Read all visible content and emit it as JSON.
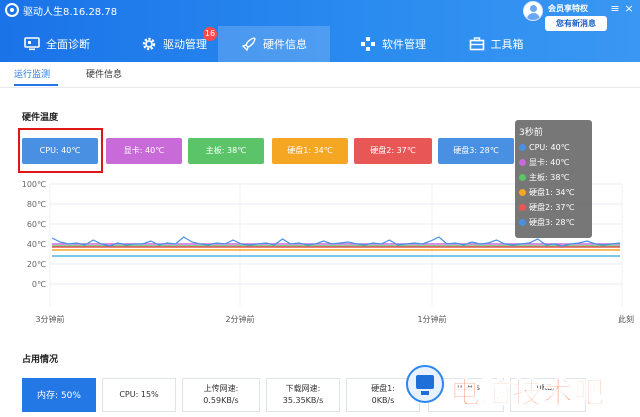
{
  "app": {
    "title": "驱动人生8.16.28.78",
    "vip_label": "会员享特权",
    "sale_badge": "您有新消息"
  },
  "tabs": [
    {
      "label": "全面诊断",
      "icon": "monitor-icon"
    },
    {
      "label": "驱动管理",
      "icon": "gear-icon",
      "badge": "16"
    },
    {
      "label": "硬件信息",
      "icon": "rocket-icon",
      "active": true
    },
    {
      "label": "软件管理",
      "icon": "apps-icon"
    },
    {
      "label": "工具箱",
      "icon": "toolbox-icon"
    }
  ],
  "subtabs": [
    {
      "label": "运行监测",
      "active": true
    },
    {
      "label": "硬件信息"
    }
  ],
  "temperature": {
    "section_title": "硬件温度",
    "buttons": [
      {
        "label": "CPU: 40℃",
        "color": "#4a90e2"
      },
      {
        "label": "显卡: 40℃",
        "color": "#c86ad8"
      },
      {
        "label": "主板: 38℃",
        "color": "#5cc468"
      },
      {
        "label": "硬盘1: 34℃",
        "color": "#f5a623"
      },
      {
        "label": "硬盘2: 37℃",
        "color": "#e85656"
      },
      {
        "label": "硬盘3: 28℃",
        "color": "#4a90e2"
      }
    ]
  },
  "chart_data": {
    "type": "line",
    "title": "",
    "xlabel": "",
    "ylabel": "",
    "y_ticks": [
      "100℃",
      "80℃",
      "60℃",
      "40℃",
      "20℃",
      "0℃"
    ],
    "ylim": [
      0,
      100
    ],
    "x_ticks": [
      "3分钟前",
      "2分钟前",
      "1分钟前",
      "此刻"
    ],
    "grid": true,
    "series": [
      {
        "name": "CPU",
        "color": "#4a90e2",
        "values": [
          46,
          42,
          40,
          41,
          39,
          44,
          40,
          38,
          41,
          39,
          40,
          40,
          43,
          39,
          41,
          40,
          47,
          42,
          40,
          39,
          41,
          40,
          44,
          40,
          39,
          40,
          41,
          39,
          45,
          40,
          41,
          39,
          40,
          43,
          40,
          41,
          42,
          40,
          39,
          41,
          40,
          44,
          39,
          40,
          41,
          40,
          43,
          47,
          40,
          41,
          39,
          42,
          40,
          41,
          44,
          40,
          39,
          40,
          41,
          45,
          39,
          40,
          38,
          40,
          41,
          43,
          40,
          39,
          40,
          41
        ]
      },
      {
        "name": "显卡",
        "color": "#c86ad8",
        "values": [
          40,
          40,
          40,
          40,
          40,
          40,
          40,
          40,
          40,
          40,
          40,
          40,
          40,
          40,
          40,
          40,
          40,
          40,
          40,
          40,
          40,
          40,
          40,
          40,
          40,
          40,
          40,
          40,
          40,
          40,
          40,
          40,
          40,
          40,
          40,
          40,
          40,
          40,
          40,
          40,
          40,
          40,
          40,
          40,
          40,
          40,
          40,
          40,
          40,
          40,
          40,
          40,
          40,
          40,
          40,
          40,
          40,
          40,
          40,
          40,
          40,
          40,
          40,
          40,
          40,
          40,
          40,
          40,
          40,
          40
        ]
      },
      {
        "name": "主板",
        "color": "#5cc468",
        "values": [
          38,
          38,
          38,
          38,
          38,
          38,
          38,
          38,
          38,
          38,
          38,
          38,
          38,
          38,
          38,
          38,
          38,
          38,
          38,
          38,
          38,
          38,
          38,
          38,
          38,
          38,
          38,
          38,
          38,
          38,
          38,
          38,
          38,
          38,
          38,
          38,
          38,
          38,
          38,
          38,
          38,
          38,
          38,
          38,
          38,
          38,
          38,
          38,
          38,
          38,
          38,
          38,
          38,
          38,
          38,
          38,
          38,
          38,
          38,
          38,
          38,
          38,
          38,
          38,
          38,
          38,
          38,
          38,
          38,
          38
        ]
      },
      {
        "name": "硬盘1",
        "color": "#f5a623",
        "values": [
          34,
          34,
          34,
          34,
          34,
          34,
          34,
          34,
          34,
          34,
          34,
          34,
          34,
          34,
          34,
          34,
          34,
          34,
          34,
          34,
          34,
          34,
          34,
          34,
          34,
          34,
          34,
          34,
          34,
          34,
          34,
          34,
          34,
          34,
          34,
          34,
          34,
          34,
          34,
          34,
          34,
          34,
          34,
          34,
          34,
          34,
          34,
          34,
          34,
          34,
          34,
          34,
          34,
          34,
          34,
          34,
          34,
          34,
          34,
          34,
          34,
          34,
          34,
          34,
          34,
          34,
          34,
          34,
          34,
          34
        ]
      },
      {
        "name": "硬盘2",
        "color": "#e85656",
        "values": [
          37,
          37,
          37,
          37,
          37,
          37,
          37,
          37,
          37,
          37,
          37,
          37,
          37,
          37,
          37,
          37,
          37,
          37,
          37,
          37,
          37,
          37,
          37,
          37,
          37,
          37,
          37,
          37,
          37,
          37,
          37,
          37,
          37,
          37,
          37,
          37,
          37,
          37,
          37,
          37,
          37,
          37,
          37,
          37,
          37,
          37,
          37,
          37,
          37,
          37,
          37,
          37,
          37,
          37,
          37,
          37,
          37,
          37,
          37,
          37,
          37,
          37,
          37,
          37,
          37,
          37,
          37,
          37,
          37,
          37
        ]
      },
      {
        "name": "硬盘3",
        "color": "#4fb3e6",
        "values": [
          28,
          28,
          28,
          28,
          28,
          28,
          28,
          28,
          28,
          28,
          28,
          28,
          28,
          28,
          28,
          28,
          28,
          28,
          28,
          28,
          28,
          28,
          28,
          28,
          28,
          28,
          28,
          28,
          28,
          28,
          28,
          28,
          28,
          28,
          28,
          28,
          28,
          28,
          28,
          28,
          28,
          28,
          28,
          28,
          28,
          28,
          28,
          28,
          28,
          28,
          28,
          28,
          28,
          28,
          28,
          28,
          28,
          28,
          28,
          28,
          28,
          28,
          28,
          28,
          28,
          28,
          28,
          28,
          28,
          28
        ]
      }
    ],
    "tooltip": {
      "title": "3秒前",
      "rows": [
        {
          "label": "CPU: 40℃",
          "color": "#4a90e2"
        },
        {
          "label": "显卡: 40℃",
          "color": "#c86ad8"
        },
        {
          "label": "主板: 38℃",
          "color": "#5cc468"
        },
        {
          "label": "硬盘1: 34℃",
          "color": "#f5a623"
        },
        {
          "label": "硬盘2: 37℃",
          "color": "#e85656"
        },
        {
          "label": "硬盘3: 28℃",
          "color": "#4a90e2"
        }
      ]
    }
  },
  "usage": {
    "section_title": "占用情况",
    "items": [
      {
        "line1": "内存: 50%",
        "active": true
      },
      {
        "line1": "CPU: 15%"
      },
      {
        "line1": "上传网速:",
        "line2": "0.59KB/s"
      },
      {
        "line1": "下载网速:",
        "line2": "35.35KB/s"
      },
      {
        "line1": "硬盘1:",
        "line2": "0KB/s"
      },
      {
        "line1": "",
        "line2": "39KB/s"
      },
      {
        "line1": "",
        "line2": "0KB/s"
      }
    ]
  },
  "watermark": {
    "text": "电脑技术吧"
  }
}
